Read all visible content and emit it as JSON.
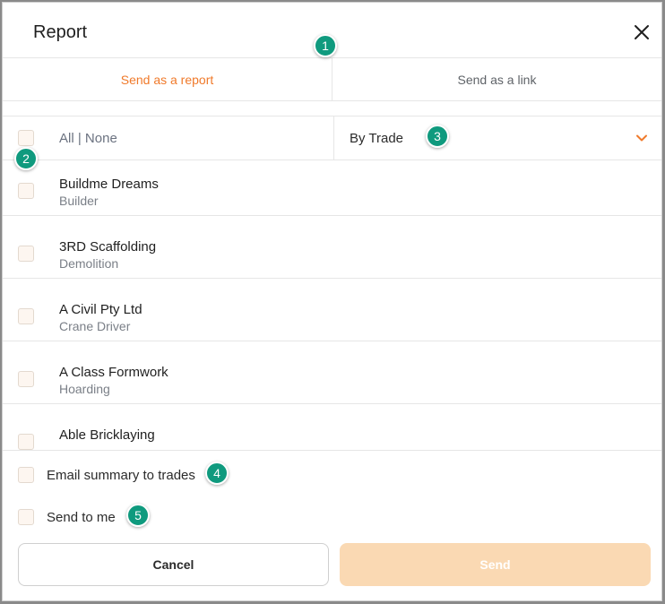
{
  "dialog": {
    "title": "Report",
    "close_icon": "close-icon"
  },
  "tabs": [
    {
      "label": "Send as a report",
      "active": true
    },
    {
      "label": "Send as a link",
      "active": false
    }
  ],
  "filter": {
    "all_label": "All",
    "separator": "|",
    "none_label": "None",
    "group_by_value": "By Trade",
    "chevron_icon": "chevron-down-icon"
  },
  "companies": [
    {
      "name": "Buildme Dreams",
      "trade": "Builder"
    },
    {
      "name": "3RD Scaffolding",
      "trade": "Demolition"
    },
    {
      "name": "A Civil Pty Ltd",
      "trade": "Crane Driver"
    },
    {
      "name": "A Class Formwork",
      "trade": "Hoarding"
    },
    {
      "name": "Able Bricklaying",
      "trade": ""
    }
  ],
  "options": {
    "email_summary_label": "Email summary to trades",
    "send_to_me_label": "Send to me"
  },
  "buttons": {
    "cancel_label": "Cancel",
    "send_label": "Send"
  },
  "markers": [
    "1",
    "2",
    "3",
    "4",
    "5"
  ],
  "colors": {
    "accent": "#f07a2b",
    "send_disabled": "#fad9b3",
    "marker": "#0f9a7e"
  }
}
